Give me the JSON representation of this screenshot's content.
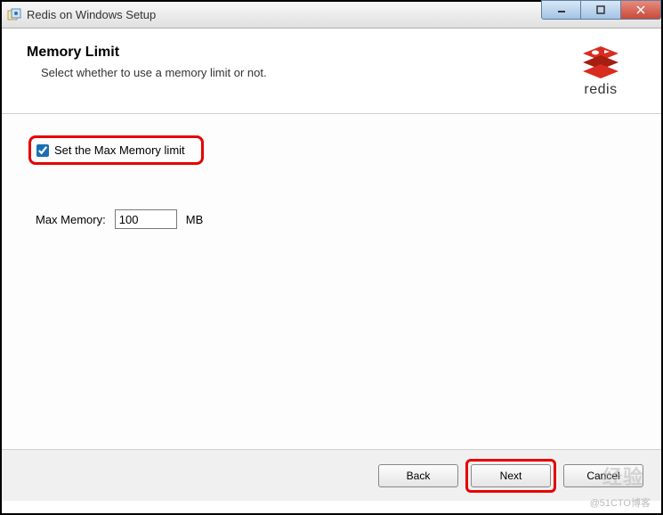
{
  "window": {
    "title": "Redis on Windows Setup"
  },
  "header": {
    "title": "Memory Limit",
    "subtitle": "Select whether to use a memory limit or not.",
    "logo_text": "redis"
  },
  "content": {
    "checkbox_label": "Set the Max Memory limit",
    "checkbox_checked": true,
    "maxmem_label": "Max Memory:",
    "maxmem_value": "100",
    "maxmem_unit": "MB"
  },
  "footer": {
    "back": "Back",
    "next": "Next",
    "cancel": "Cancel"
  },
  "watermark": "@51CTO博客",
  "watermark_bg": "经验"
}
